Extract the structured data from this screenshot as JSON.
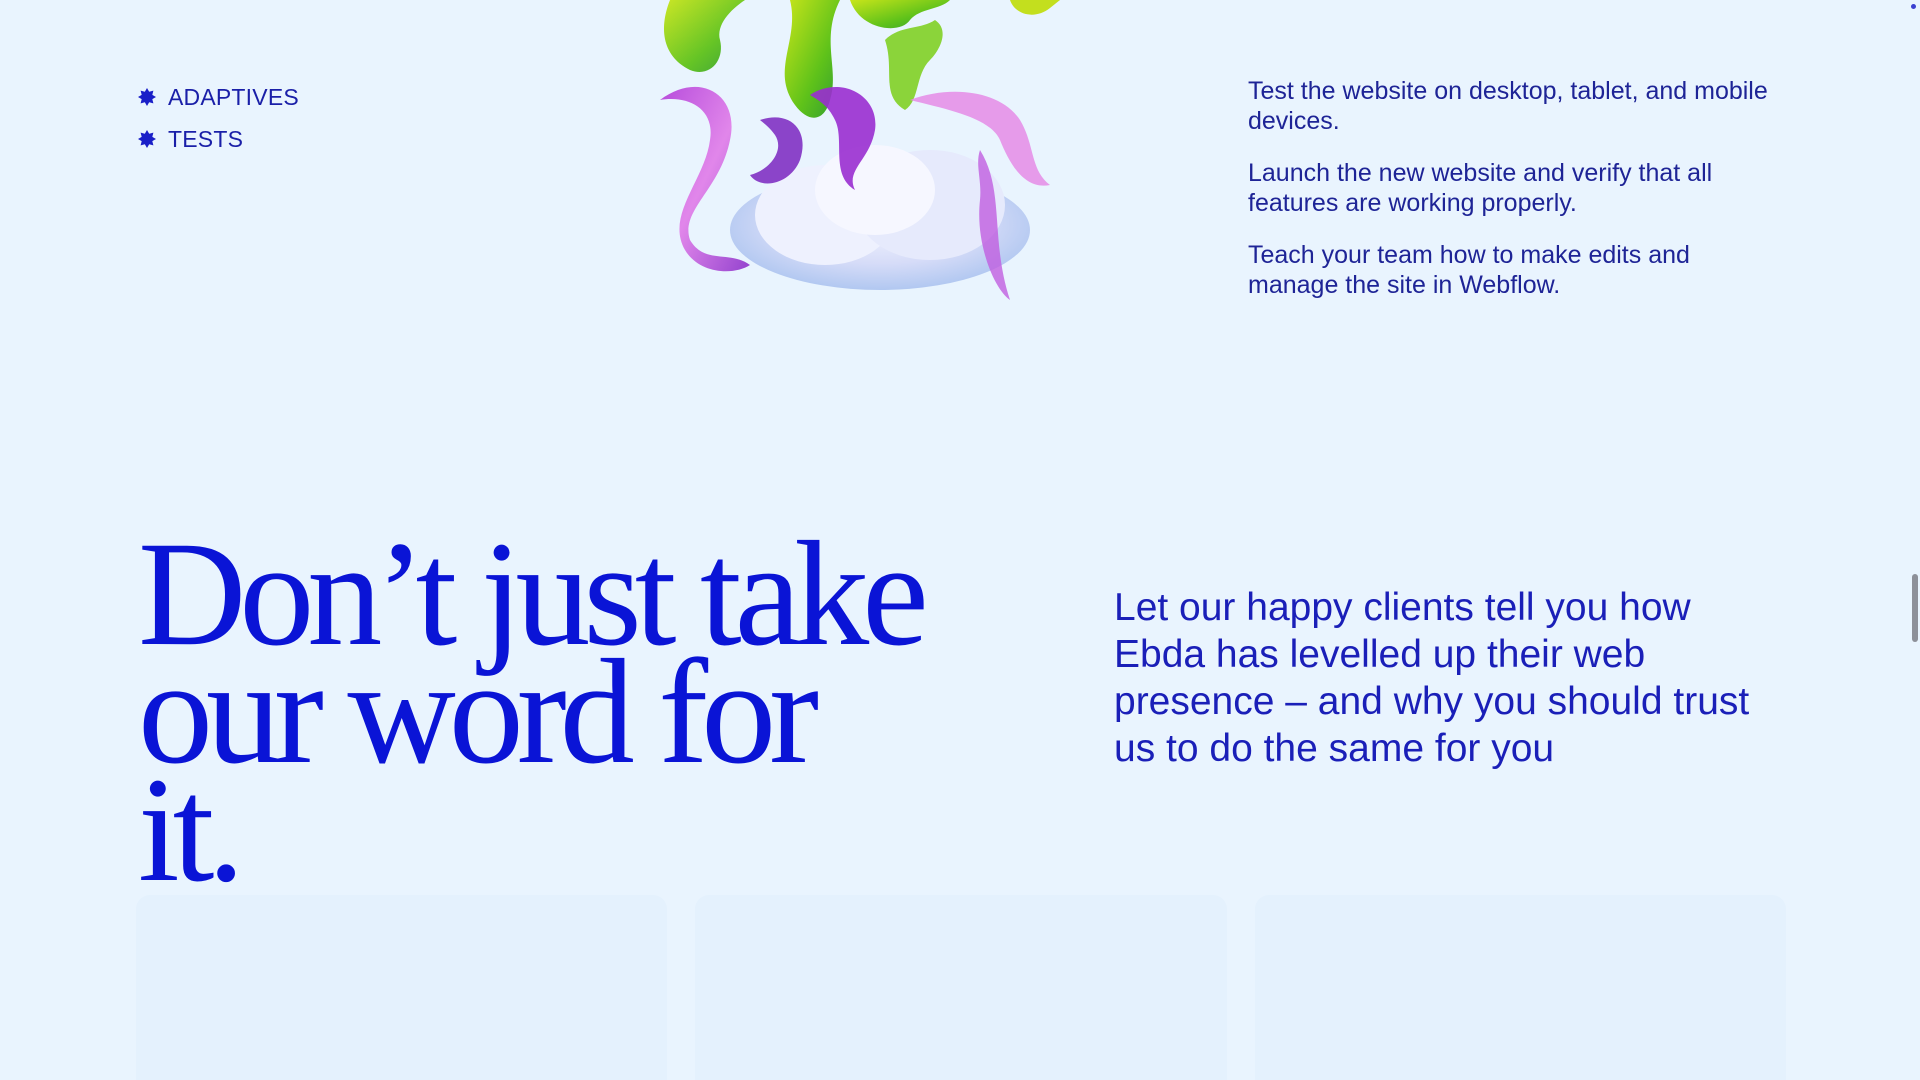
{
  "tags": [
    {
      "label": "ADAPTIVES",
      "icon": "starburst-icon"
    },
    {
      "label": "TESTS",
      "icon": "starburst-icon"
    }
  ],
  "art": {
    "icon": "abstract-3d-sculpture-illustration"
  },
  "steps": [
    "Test the website on desktop, tablet, and mobile devices.",
    "Launch the new website and verify that all features are working properly.",
    "Teach your team how to make edits and manage the site in Webflow."
  ],
  "testimonials": {
    "headline_line1": "Don’t just take",
    "headline_line2": "our word for it.",
    "lead": "Let our happy clients tell you how Ebda has levelled up their web presence – and why you should trust us to do the same for you"
  },
  "colors": {
    "background": "#e9f4fe",
    "headline": "#0a14d6",
    "text": "#1a1fa8"
  }
}
